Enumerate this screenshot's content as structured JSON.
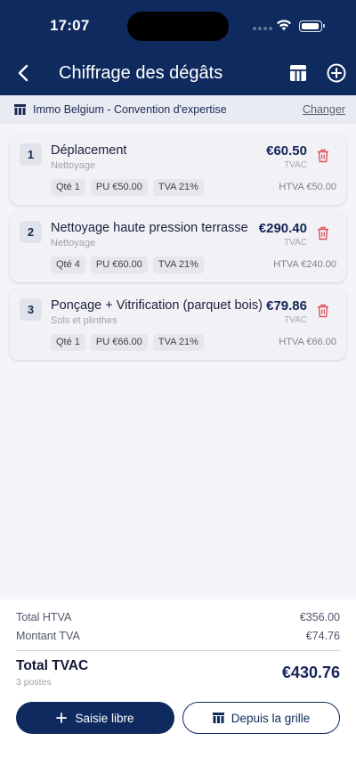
{
  "status_bar": {
    "time": "17:07"
  },
  "header": {
    "title": "Chiffrage des dégâts",
    "back_icon": "chevron-left-icon",
    "grid_icon": "table-grid-icon",
    "add_icon": "plus-circle-icon"
  },
  "convention": {
    "label": "Immo Belgium - Convention d'expertise",
    "change_label": "Changer"
  },
  "items": [
    {
      "number": "1",
      "title": "Déplacement",
      "category": "Nettoyage",
      "amount": "€60.50",
      "amount_note": "TVAC",
      "qty": "Qté 1",
      "unit_price": "PU €50.00",
      "vat": "TVA 21%",
      "htva": "HTVA €50.00"
    },
    {
      "number": "2",
      "title": "Nettoyage haute pression terrasse",
      "category": "Nettoyage",
      "amount": "€290.40",
      "amount_note": "TVAC",
      "qty": "Qté 4",
      "unit_price": "PU €60.00",
      "vat": "TVA 21%",
      "htva": "HTVA €240.00"
    },
    {
      "number": "3",
      "title": "Ponçage + Vitrification (parquet bois)",
      "category": "Sols et plinthes",
      "amount": "€79.86",
      "amount_note": "TVAC",
      "qty": "Qté 1",
      "unit_price": "PU €66.00",
      "vat": "TVA 21%",
      "htva": "HTVA €66.00"
    }
  ],
  "summary": {
    "total_htva_label": "Total HTVA",
    "total_htva_value": "€356.00",
    "vat_label": "Montant TVA",
    "vat_value": "€74.76",
    "total_label": "Total TVAC",
    "total_count": "3 postes",
    "total_value": "€430.76"
  },
  "actions": {
    "free_entry": "Saisie libre",
    "from_grid": "Depuis la grille"
  },
  "colors": {
    "primary": "#0f2a5e",
    "danger": "#e0505a",
    "background": "#f5f5f9"
  }
}
